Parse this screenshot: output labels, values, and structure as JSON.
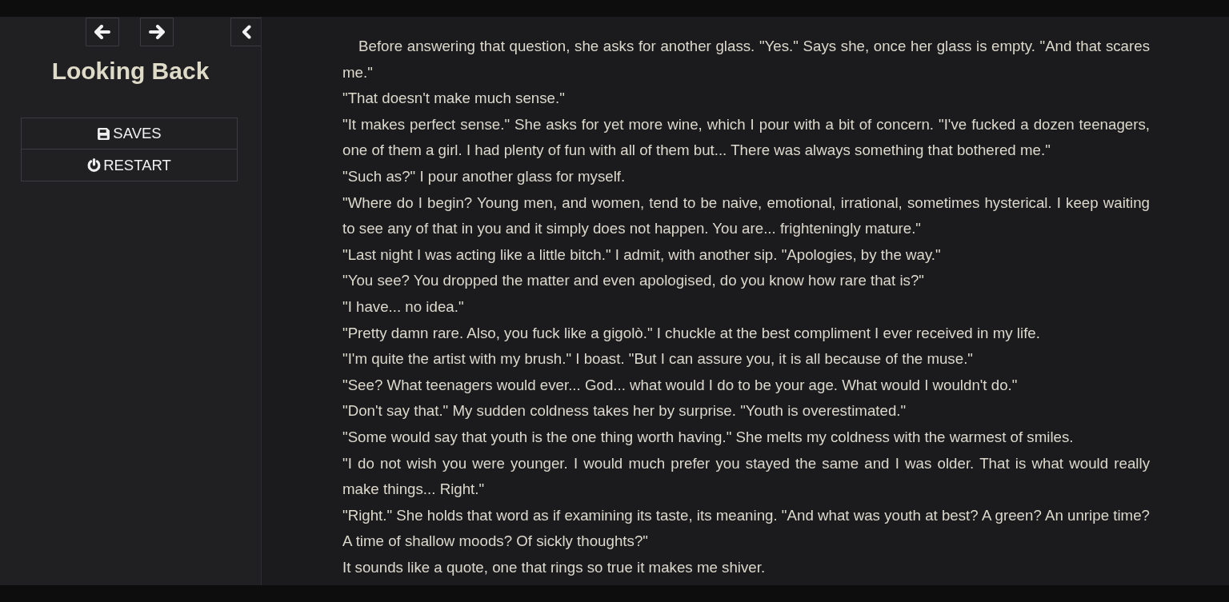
{
  "sidebar": {
    "title": "Looking Back",
    "menu": [
      {
        "label": "SAVES",
        "kind": "saves"
      },
      {
        "label": "RESTART",
        "kind": "restart"
      }
    ]
  },
  "passage": {
    "paragraphs": [
      {
        "text": "Before answering that question, she asks for another glass. \"Yes.\" Says she, once her glass is empty. \"And that scares me.\"",
        "indented": true
      },
      {
        "text": "\"That doesn't make much sense.\"",
        "indented": false
      },
      {
        "text": "\"It makes perfect sense.\" She asks for yet more wine, which I pour with a bit of concern. \"I've fucked a dozen teenagers, one of them a girl. I had plenty of fun with all of them but... There was always something that bothered me.\"",
        "indented": false
      },
      {
        "text": "\"Such as?\" I pour another glass for myself.",
        "indented": false
      },
      {
        "text": "\"Where do I begin? Young men, and women, tend to be naive, emotional, irrational, sometimes hysterical. I keep waiting to see any of that in you and it simply does not happen. You are... frighteningly mature.\"",
        "indented": false
      },
      {
        "text": "\"Last night I was acting like a little bitch.\" I admit, with another sip. \"Apologies, by the way.\"",
        "indented": false
      },
      {
        "text": "\"You see? You dropped the matter and even apologised, do you know how rare that is?\"",
        "indented": false
      },
      {
        "text": "\"I have... no idea.\"",
        "indented": false
      },
      {
        "text": "\"Pretty damn rare. Also, you fuck like a gigolò.\" I chuckle at the best compliment I ever received in my life.",
        "indented": false
      },
      {
        "text": "\"I'm quite the artist with my brush.\" I boast. \"But I can assure you, it is all because of the muse.\"",
        "indented": false
      },
      {
        "text": "\"See? What teenagers would ever... God... what would I do to be your age. What would I wouldn't do.\"",
        "indented": false
      },
      {
        "text": "\"Don't say that.\" My sudden coldness takes her by surprise. \"Youth is overestimated.\"",
        "indented": false
      },
      {
        "text": "\"Some would say that youth is the one thing worth having.\" She melts my coldness with the warmest of smiles.",
        "indented": false
      },
      {
        "text": "\"I do not wish you were younger. I would much prefer you stayed the same and I was older. That is what would really make things... Right.\"",
        "indented": false
      },
      {
        "text": "\"Right.\" She holds that word as if examining its taste, its meaning. \"And what was youth at best? A green? An unripe time? A time of shallow moods? Of sickly thoughts?\"",
        "indented": false
      },
      {
        "text": "It sounds like a quote, one that rings so true it makes me shiver.",
        "indented": false
      }
    ]
  }
}
